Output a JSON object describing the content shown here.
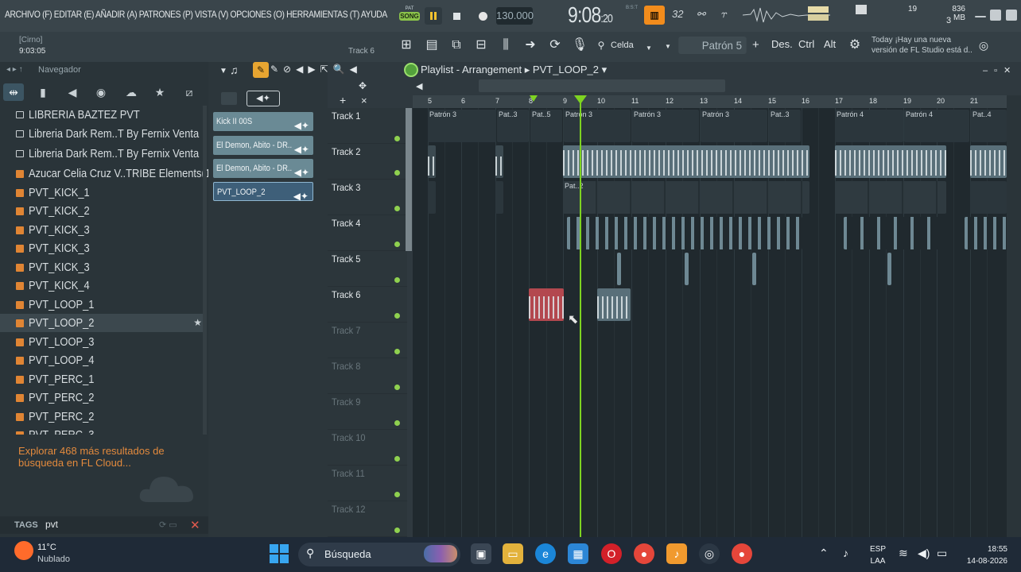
{
  "menu": "ARCHIVO (F)  EDITAR (E)  AÑADIR (A)  PATRONES (P)  VISTA (V)  OPCIONES (O)  HERRAMIENTAS (T)  AYUDA",
  "transport": {
    "pat_label": "PAT",
    "song_label": "SONG",
    "tempo": "130.000",
    "time_main": "9:08",
    "time_sub": ":20",
    "bst": "B:S:T"
  },
  "toolbar_icons": {
    "icon1": "▥",
    "icon2": "32",
    "icon3": "⚯",
    "icon4": "⥾"
  },
  "cpu": {
    "value": "19"
  },
  "memory": {
    "mb": "836 MB",
    "count": "3"
  },
  "hint": {
    "title": "[Cirno]",
    "time": "9:03:05",
    "track": "Track 6"
  },
  "snap": {
    "label": "Celda"
  },
  "pattern": {
    "name": "Patrón 5",
    "plus": "+"
  },
  "keys": {
    "des": "Des.",
    "ctrl": "Ctrl",
    "alt": "Alt"
  },
  "news": "Today  ¡Hay una nueva versión de FL Studio está d..",
  "browser": {
    "title": "Navegador",
    "items": [
      {
        "label": "LIBRERIA BAZTEZ  PVT",
        "type": "folder"
      },
      {
        "label": "Libreria Dark Rem..T By Fernix Venta",
        "type": "folder"
      },
      {
        "label": "Libreria Dark Rem..T By Fernix Venta",
        "type": "folder"
      },
      {
        "label": "Azucar Celia Cruz V..TRIBE Elements(1)",
        "type": "audio"
      },
      {
        "label": "PVT_KICK_1",
        "type": "audio"
      },
      {
        "label": "PVT_KICK_2",
        "type": "audio"
      },
      {
        "label": "PVT_KICK_3",
        "type": "audio"
      },
      {
        "label": "PVT_KICK_3",
        "type": "audio"
      },
      {
        "label": "PVT_KICK_3",
        "type": "audio"
      },
      {
        "label": "PVT_KICK_4",
        "type": "audio"
      },
      {
        "label": "PVT_LOOP_1",
        "type": "audio"
      },
      {
        "label": "PVT_LOOP_2",
        "type": "audio",
        "selected": true
      },
      {
        "label": "PVT_LOOP_3",
        "type": "audio"
      },
      {
        "label": "PVT_LOOP_4",
        "type": "audio"
      },
      {
        "label": "PVT_PERC_1",
        "type": "audio"
      },
      {
        "label": "PVT_PERC_2",
        "type": "audio"
      },
      {
        "label": "PVT_PERC_2",
        "type": "audio"
      },
      {
        "label": "PVT_PERC_3",
        "type": "audio"
      }
    ],
    "cloud_text": "Explorar 468 más resultados de búsqueda en FL Cloud...",
    "tags_label": "TAGS",
    "tags_value": "pvt"
  },
  "playlist": {
    "title": "Playlist - Arrangement",
    "current": "PVT_LOOP_2",
    "picker": [
      "Kick II 00S",
      "El Demon, Abito - DR..",
      "El Demon, Abito - DR..",
      "PVT_LOOP_2"
    ],
    "tracks": [
      "Track 1",
      "Track 2",
      "Track 3",
      "Track 4",
      "Track 5",
      "Track 6",
      "Track 7",
      "Track 8",
      "Track 9",
      "Track 10",
      "Track 11",
      "Track 12"
    ],
    "bars": [
      "5",
      "6",
      "7",
      "8",
      "9",
      "10",
      "11",
      "12",
      "13",
      "14",
      "15",
      "16",
      "17",
      "18",
      "19",
      "20",
      "21"
    ],
    "track1_clips": [
      "Patrón 3",
      "Pat..3",
      "Pat..5",
      "Patrón 3",
      "Patrón 3",
      "Patrón 3",
      "Pat..3",
      "Patrón 4",
      "Patrón 4",
      "Pat..4"
    ],
    "track3_clip": "Pat..2"
  },
  "taskbar": {
    "weather_temp": "11°C",
    "weather_desc": "Nublado",
    "search": "Búsqueda",
    "lang1": "ESP",
    "lang2": "LAA",
    "time": "18:55",
    "date": "14-08-2026"
  }
}
